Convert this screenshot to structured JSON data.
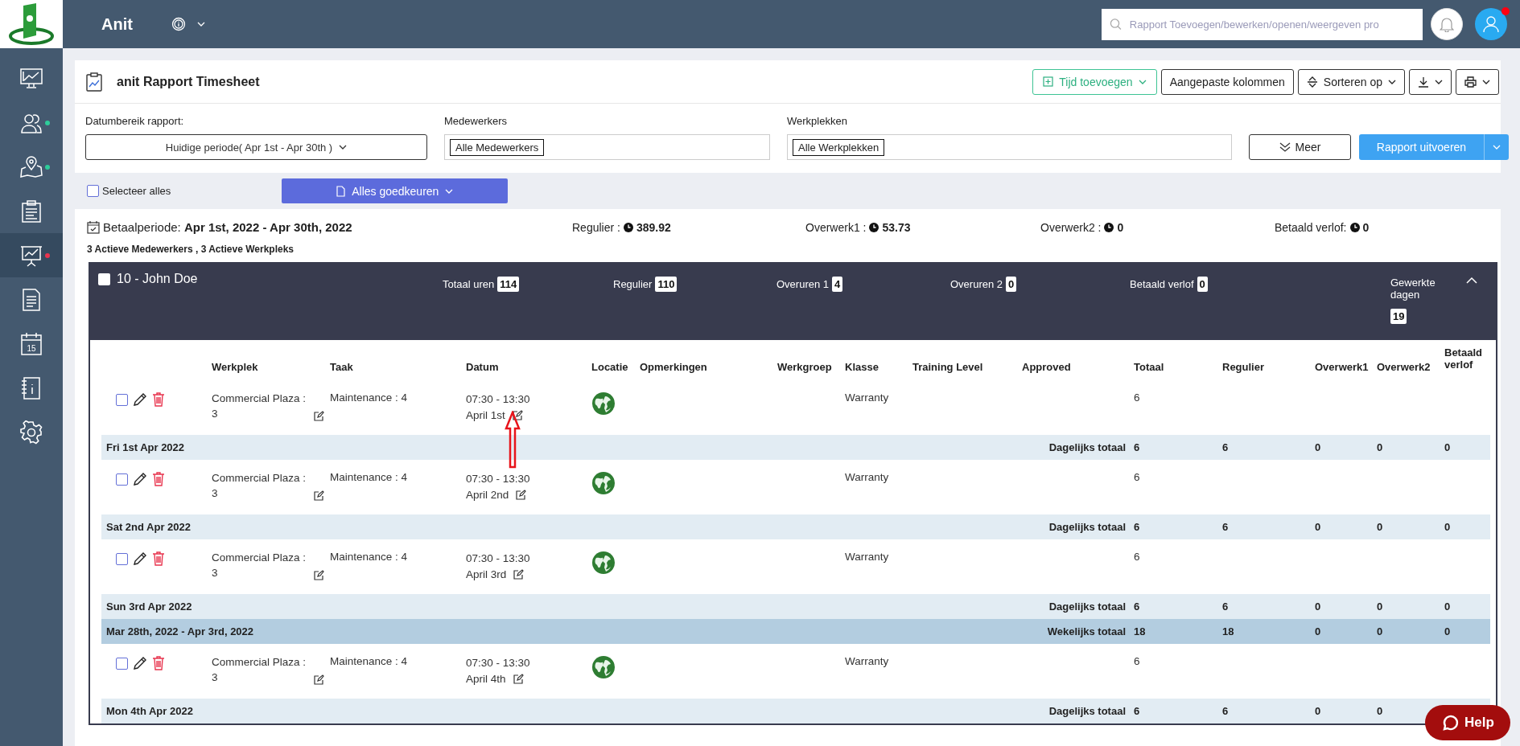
{
  "app": {
    "name": "Anit",
    "search_placeholder": "Rapport Toevoegen/bewerken/openen/weergeven pro",
    "notification": true
  },
  "sidebar": [
    {
      "kind": "dashboard",
      "active": false
    },
    {
      "kind": "users",
      "active": false,
      "color": "#2ecc9a"
    },
    {
      "kind": "map",
      "active": false,
      "color": "#2ecc9a"
    },
    {
      "kind": "clipboard",
      "active": false
    },
    {
      "kind": "presentation",
      "active": true,
      "color": "#e8344e"
    },
    {
      "kind": "document",
      "active": false
    },
    {
      "kind": "calendar",
      "active": false,
      "text": "15"
    },
    {
      "kind": "notebook",
      "active": false
    },
    {
      "kind": "settings",
      "active": false
    }
  ],
  "report": {
    "title": "anit Rapport Timesheet",
    "toolbar": [
      {
        "kind": "add",
        "label": "Tijd toevoegen"
      },
      {
        "kind": "plain",
        "label": "Aangepaste kolommen"
      },
      {
        "kind": "sort",
        "label": "Sorteren op"
      },
      {
        "kind": "download"
      },
      {
        "kind": "print"
      }
    ],
    "filters": [
      {
        "kind": "dropdown",
        "label": "Datumbereik rapport:",
        "value": "Huidige periode( Apr 1st - Apr 30th )"
      },
      {
        "kind": "tags",
        "label": "Medewerkers",
        "tag": "Alle Medewerkers"
      },
      {
        "kind": "tags",
        "label": "Werkplekken",
        "tag": "Alle Werkplekken"
      }
    ],
    "more_button": "Meer",
    "run_button": "Rapport uitvoeren"
  },
  "select_all": {
    "label": "Selecteer alles",
    "checked": false
  },
  "approve_button": "Alles goedkeuren",
  "summary": {
    "period": "Betaalperiode: **Apr 1st, 2022 - Apr 30th, 2022**",
    "totals": [
      {
        "label": "Regulier :",
        "value": "389.92"
      },
      {
        "label": "Overwerk1 :",
        "value": "53.73"
      },
      {
        "label": "Overwerk2 :",
        "value": "0"
      },
      {
        "label": "Betaald verlof:",
        "value": "0"
      }
    ],
    "active": "3 Actieve Medewerkers , 3 Actieve Werkpleks"
  },
  "employee": {
    "name": "10 - John Doe",
    "checked": false,
    "expanded": true,
    "stats": [
      {
        "label": "Totaal uren",
        "value": "114"
      },
      {
        "label": "Regulier",
        "value": "110"
      },
      {
        "label": "Overuren 1",
        "value": "4"
      },
      {
        "label": "Overuren 2",
        "value": "0"
      },
      {
        "label": "Betaald verlof",
        "value": "0"
      },
      {
        "label": "Gewerkte dagen",
        "value": "19"
      }
    ],
    "columns": [
      "Werkplek",
      "Taak",
      "Datum",
      "Locatie",
      "Opmerkingen",
      "Werkgroep",
      "Klasse",
      "Training Level",
      "Approved",
      "Totaal",
      "Regulier",
      "Overwerk1",
      "Overwerk2",
      "Betaald verlof"
    ],
    "rows": [
      {
        "kind": "entry",
        "checked": false,
        "marked": true,
        "werkplek": "Commercial Plaza : 3",
        "taak": "Maintenance : 4",
        "time": "07:30 - 13:30",
        "date": "April 1st",
        "klasse": "Warranty",
        "totaal": "6"
      },
      {
        "kind": "day",
        "date": "Fri 1st Apr 2022",
        "label": "Dagelijks totaal",
        "values": [
          "6",
          "6",
          "0",
          "0",
          "0"
        ]
      },
      {
        "kind": "entry",
        "checked": false,
        "marked": false,
        "werkplek": "Commercial Plaza : 3",
        "taak": "Maintenance : 4",
        "time": "07:30 - 13:30",
        "date": "April 2nd",
        "klasse": "Warranty",
        "totaal": "6"
      },
      {
        "kind": "day",
        "date": "Sat 2nd Apr 2022",
        "label": "Dagelijks totaal",
        "values": [
          "6",
          "6",
          "0",
          "0",
          "0"
        ]
      },
      {
        "kind": "entry",
        "checked": false,
        "marked": false,
        "werkplek": "Commercial Plaza : 3",
        "taak": "Maintenance : 4",
        "time": "07:30 - 13:30",
        "date": "April 3rd",
        "klasse": "Warranty",
        "totaal": "6"
      },
      {
        "kind": "day",
        "date": "Sun 3rd Apr 2022",
        "label": "Dagelijks totaal",
        "values": [
          "6",
          "6",
          "0",
          "0",
          "0"
        ]
      },
      {
        "kind": "week",
        "date": "Mar 28th, 2022  -  Apr 3rd, 2022",
        "label": "Wekelijks totaal",
        "values": [
          "18",
          "18",
          "0",
          "0",
          "0"
        ]
      },
      {
        "kind": "entry",
        "checked": false,
        "marked": false,
        "werkplek": "Commercial Plaza : 3",
        "taak": "Maintenance : 4",
        "time": "07:30 - 13:30",
        "date": "April 4th",
        "klasse": "Warranty",
        "totaal": "6"
      },
      {
        "kind": "day",
        "date": "Mon 4th Apr 2022",
        "label": "Dagelijks totaal",
        "values": [
          "6",
          "6",
          "0",
          "0"
        ]
      }
    ]
  },
  "help_button": "Help"
}
